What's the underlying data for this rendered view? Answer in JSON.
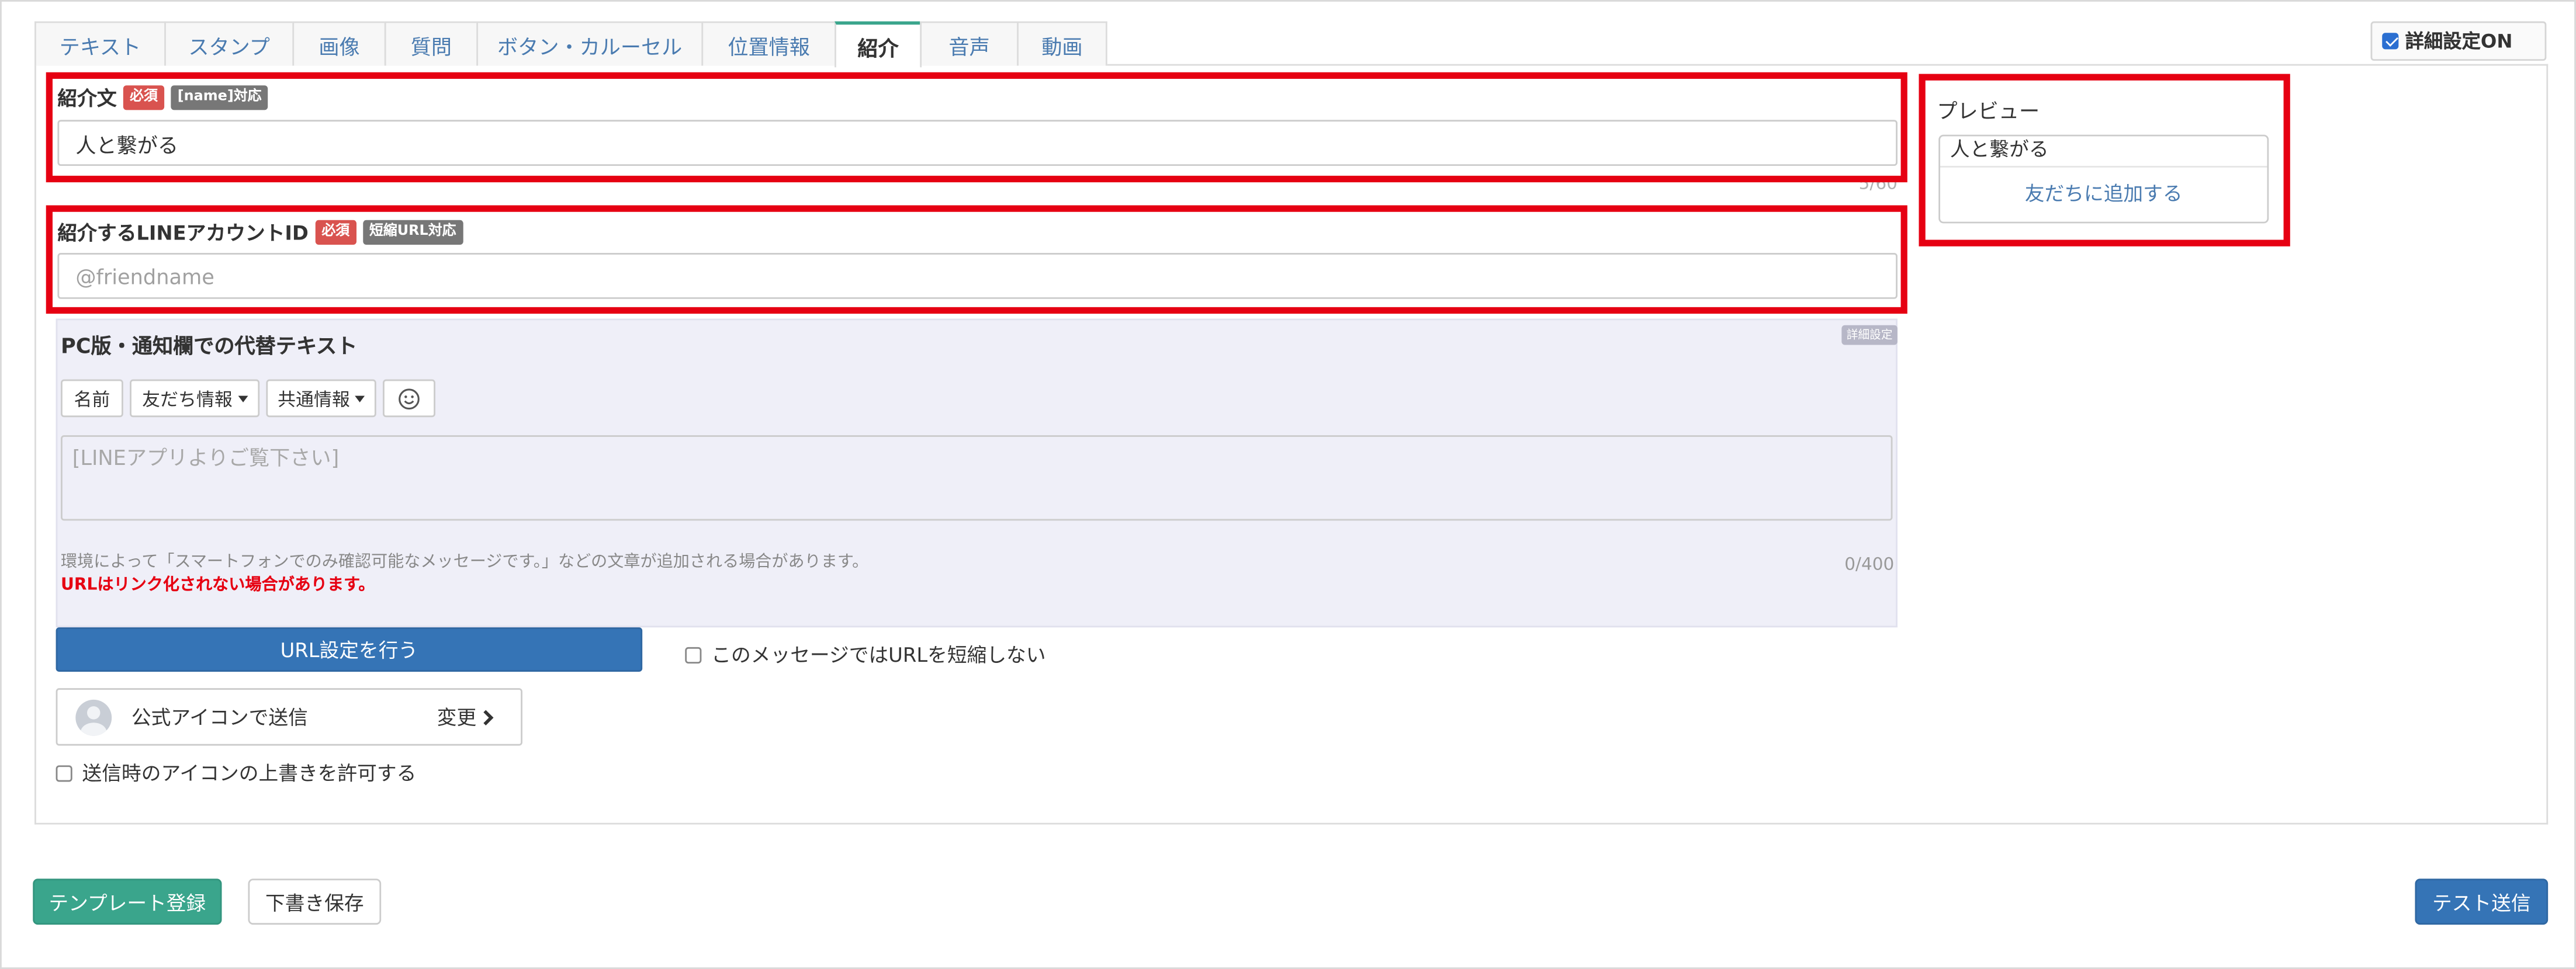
{
  "tabs": [
    {
      "label": "テキスト",
      "active": false
    },
    {
      "label": "スタンプ",
      "active": false
    },
    {
      "label": "画像",
      "active": false
    },
    {
      "label": "質問",
      "active": false
    },
    {
      "label": "ボタン・カルーセル",
      "active": false
    },
    {
      "label": "位置情報",
      "active": false
    },
    {
      "label": "紹介",
      "active": true
    },
    {
      "label": "音声",
      "active": false
    },
    {
      "label": "動画",
      "active": false
    }
  ],
  "detail_toggle": {
    "label": "詳細設定ON",
    "checked": true
  },
  "intro_field": {
    "label": "紹介文",
    "badge_required": "必須",
    "badge_name": "[name]対応",
    "value": "人と繋がる",
    "counter": "5/60"
  },
  "account_field": {
    "label": "紹介するLINEアカウントID",
    "badge_required": "必須",
    "badge_short_url": "短縮URL対応",
    "placeholder": "@friendname"
  },
  "preview": {
    "title": "プレビュー",
    "text": "人と繋がる",
    "action": "友だちに追加する"
  },
  "alt_text": {
    "title": "PC版・通知欄での代替テキスト",
    "tag": "詳細設定",
    "buttons": {
      "name": "名前",
      "friend_info": "友だち情報",
      "common_info": "共通情報"
    },
    "emoji_icon": "smiley-icon",
    "placeholder": "[LINEアプリよりご覧下さい]",
    "note": "環境によって「スマートフォンでのみ確認可能なメッセージです。」などの文章が追加される場合があります。",
    "warning": "URLはリンク化されない場合があります。",
    "counter": "0/400"
  },
  "url_button": "URL設定を行う",
  "no_shorten": {
    "label": "このメッセージではURLを短縮しない",
    "checked": false
  },
  "sender_icon": {
    "label": "公式アイコンで送信",
    "change": "変更"
  },
  "allow_override": {
    "label": "送信時のアイコンの上書きを許可する",
    "checked": false
  },
  "footer": {
    "template_button": "テンプレート登録",
    "draft_button": "下書き保存",
    "test_button": "テスト送信"
  },
  "colors": {
    "highlight": "#e60012",
    "accent_green": "#3aa58c",
    "primary_blue": "#3574b6",
    "link_blue": "#4a7bb0"
  }
}
